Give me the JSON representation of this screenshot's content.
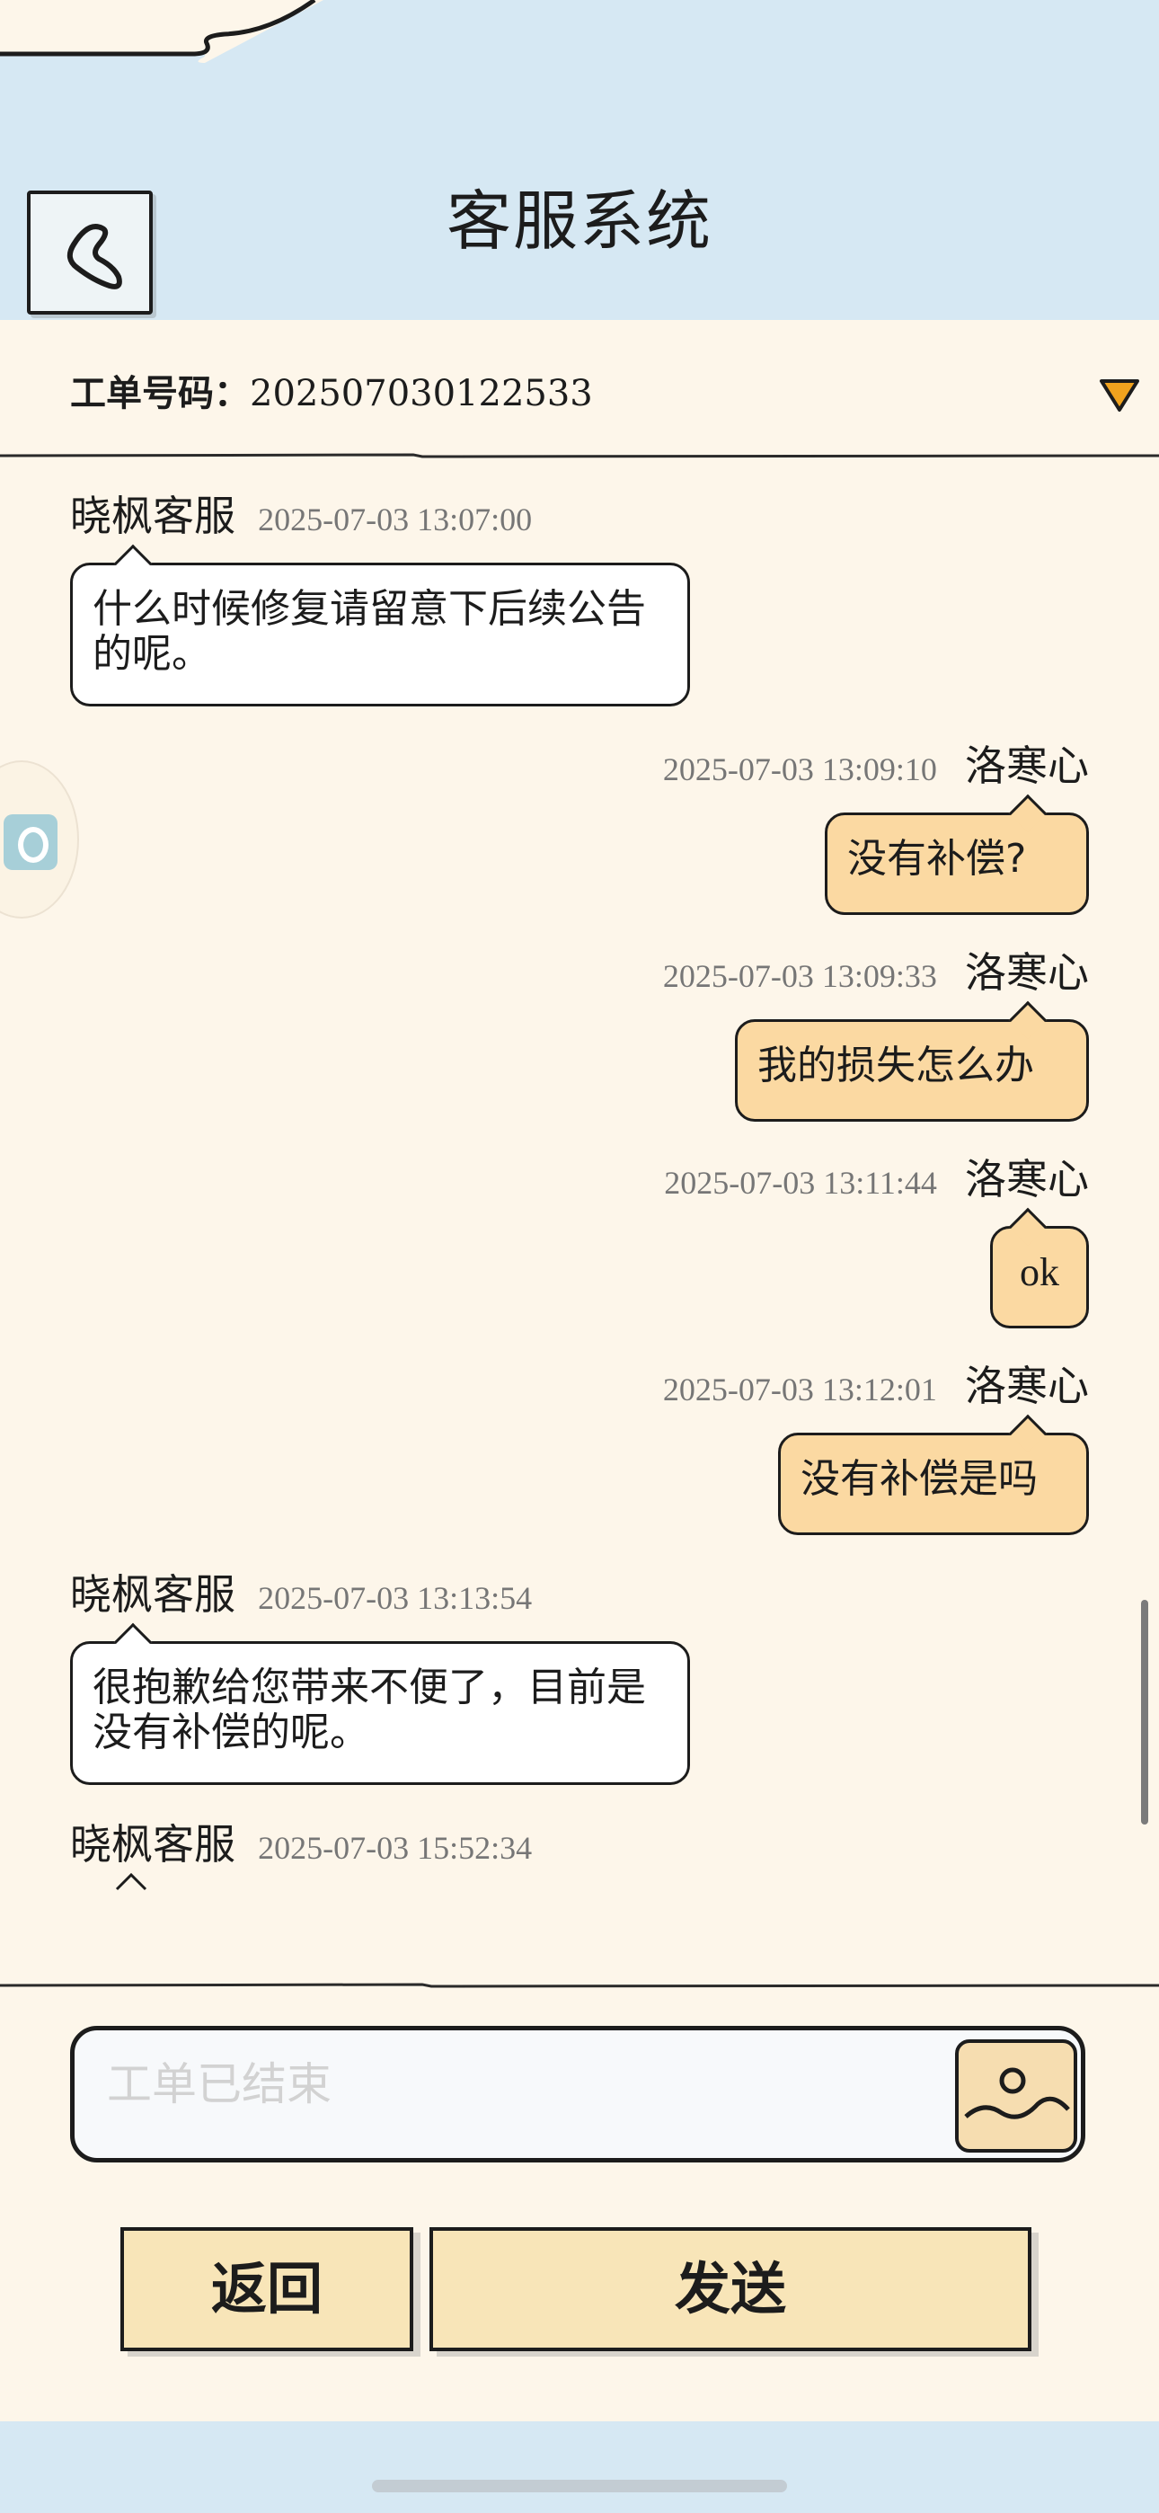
{
  "header": {
    "title": "客服系统",
    "back_icon": "chevron-left-icon"
  },
  "ticket": {
    "label": "工单号码：",
    "number": "202507030122533",
    "dropdown_icon": "triangle-down-icon"
  },
  "messages": [
    {
      "side": "left",
      "sender": "晓枫客服",
      "time": "2025-07-03 13:07:00",
      "text": "什么时候修复请留意下后续公告的呢。"
    },
    {
      "side": "right",
      "sender": "洛寒心",
      "time": "2025-07-03 13:09:10",
      "text": "没有补偿?"
    },
    {
      "side": "right",
      "sender": "洛寒心",
      "time": "2025-07-03 13:09:33",
      "text": "我的损失怎么办"
    },
    {
      "side": "right",
      "sender": "洛寒心",
      "time": "2025-07-03 13:11:44",
      "text": "ok"
    },
    {
      "side": "right",
      "sender": "洛寒心",
      "time": "2025-07-03 13:12:01",
      "text": "没有补偿是吗"
    },
    {
      "side": "left",
      "sender": "晓枫客服",
      "time": "2025-07-03 13:13:54",
      "text": "很抱歉给您带来不便了，目前是没有补偿的呢。"
    },
    {
      "side": "left",
      "sender": "晓枫客服",
      "time": "2025-07-03 15:52:34",
      "text": ""
    }
  ],
  "input": {
    "placeholder": "工单已结束",
    "image_icon": "image-icon"
  },
  "buttons": {
    "back_label": "返回",
    "send_label": "发送"
  },
  "colors": {
    "header_bg": "#d6e8f3",
    "page_bg": "#fdf6ea",
    "my_bubble": "#fbd9a2",
    "button_bg": "#f8e5b8",
    "dropdown_accent": "#f0a21e"
  }
}
